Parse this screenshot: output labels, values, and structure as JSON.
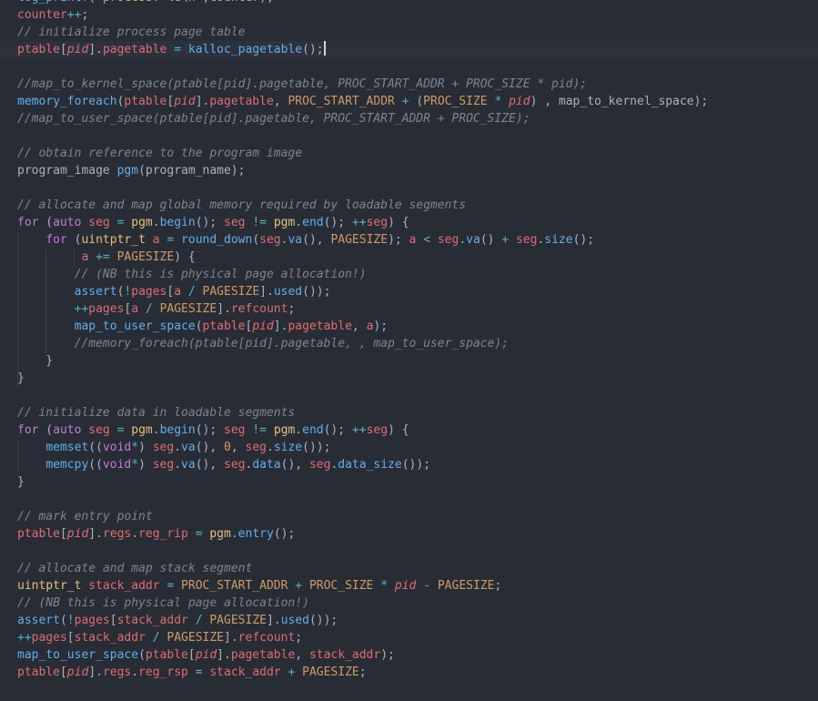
{
  "editor": {
    "current_line": 3,
    "lines": [
      [
        [
          "fn",
          "log_printf"
        ],
        [
          "plain",
          "("
        ],
        [
          "str",
          "\"process: %d\\n\""
        ],
        [
          "plain",
          ",counter);"
        ]
      ],
      [
        [
          "var",
          "counter"
        ],
        [
          "op",
          "++"
        ],
        [
          "plain",
          ";"
        ]
      ],
      [
        [
          "cmt",
          "// initialize process page table"
        ]
      ],
      [
        [
          "var",
          "ptable"
        ],
        [
          "plain",
          "["
        ],
        [
          "ital",
          "pid"
        ],
        [
          "plain",
          "]."
        ],
        [
          "var",
          "pagetable"
        ],
        [
          "plain",
          " "
        ],
        [
          "op",
          "="
        ],
        [
          "plain",
          " "
        ],
        [
          "fn",
          "kalloc_pagetable"
        ],
        [
          "plain",
          "();"
        ]
      ],
      [],
      [
        [
          "cmt",
          "//map_to_kernel_space(ptable[pid].pagetable, PROC_START_ADDR + PROC_SIZE * pid);"
        ]
      ],
      [
        [
          "fn",
          "memory_foreach"
        ],
        [
          "plain",
          "("
        ],
        [
          "var",
          "ptable"
        ],
        [
          "plain",
          "["
        ],
        [
          "ital",
          "pid"
        ],
        [
          "plain",
          "]."
        ],
        [
          "var",
          "pagetable"
        ],
        [
          "plain",
          ", "
        ],
        [
          "macro",
          "PROC_START_ADDR"
        ],
        [
          "plain",
          " "
        ],
        [
          "op",
          "+"
        ],
        [
          "plain",
          " ("
        ],
        [
          "macro",
          "PROC_SIZE"
        ],
        [
          "plain",
          " "
        ],
        [
          "op",
          "*"
        ],
        [
          "plain",
          " "
        ],
        [
          "ital",
          "pid"
        ],
        [
          "plain",
          ") , map_to_kernel_space);"
        ]
      ],
      [
        [
          "cmt",
          "//map_to_user_space(ptable[pid].pagetable, PROC_START_ADDR + PROC_SIZE);"
        ]
      ],
      [],
      [
        [
          "cmt",
          "// obtain reference to the program image"
        ]
      ],
      [
        [
          "plain",
          "program_image "
        ],
        [
          "fn",
          "pgm"
        ],
        [
          "plain",
          "(program_name);"
        ]
      ],
      [],
      [
        [
          "cmt",
          "// allocate and map global memory required by loadable segments"
        ]
      ],
      [
        [
          "kw",
          "for"
        ],
        [
          "plain",
          " ("
        ],
        [
          "kw",
          "auto"
        ],
        [
          "plain",
          " "
        ],
        [
          "var",
          "seg"
        ],
        [
          "plain",
          " "
        ],
        [
          "op",
          "="
        ],
        [
          "plain",
          " "
        ],
        [
          "type",
          "pgm"
        ],
        [
          "plain",
          "."
        ],
        [
          "fn",
          "begin"
        ],
        [
          "plain",
          "(); "
        ],
        [
          "var",
          "seg"
        ],
        [
          "plain",
          " "
        ],
        [
          "op",
          "!="
        ],
        [
          "plain",
          " "
        ],
        [
          "type",
          "pgm"
        ],
        [
          "plain",
          "."
        ],
        [
          "fn",
          "end"
        ],
        [
          "plain",
          "(); "
        ],
        [
          "op",
          "++"
        ],
        [
          "var",
          "seg"
        ],
        [
          "plain",
          ") {"
        ]
      ],
      [
        [
          "plain",
          "    "
        ],
        [
          "kw",
          "for"
        ],
        [
          "plain",
          " ("
        ],
        [
          "type",
          "uintptr_t"
        ],
        [
          "plain",
          " "
        ],
        [
          "var",
          "a"
        ],
        [
          "plain",
          " "
        ],
        [
          "op",
          "="
        ],
        [
          "plain",
          " "
        ],
        [
          "fn",
          "round_down"
        ],
        [
          "plain",
          "("
        ],
        [
          "var",
          "seg"
        ],
        [
          "plain",
          "."
        ],
        [
          "fn",
          "va"
        ],
        [
          "plain",
          "(), "
        ],
        [
          "macro",
          "PAGESIZE"
        ],
        [
          "plain",
          "); "
        ],
        [
          "var",
          "a"
        ],
        [
          "plain",
          " "
        ],
        [
          "op",
          "<"
        ],
        [
          "plain",
          " "
        ],
        [
          "var",
          "seg"
        ],
        [
          "plain",
          "."
        ],
        [
          "fn",
          "va"
        ],
        [
          "plain",
          "() "
        ],
        [
          "op",
          "+"
        ],
        [
          "plain",
          " "
        ],
        [
          "var",
          "seg"
        ],
        [
          "plain",
          "."
        ],
        [
          "fn",
          "size"
        ],
        [
          "plain",
          "();"
        ]
      ],
      [
        [
          "plain",
          "         "
        ],
        [
          "var",
          "a"
        ],
        [
          "plain",
          " "
        ],
        [
          "op",
          "+="
        ],
        [
          "plain",
          " "
        ],
        [
          "macro",
          "PAGESIZE"
        ],
        [
          "plain",
          ") {"
        ]
      ],
      [
        [
          "plain",
          "        "
        ],
        [
          "cmt",
          "// (NB this is physical page allocation!)"
        ]
      ],
      [
        [
          "plain",
          "        "
        ],
        [
          "fn",
          "assert"
        ],
        [
          "plain",
          "("
        ],
        [
          "op",
          "!"
        ],
        [
          "var",
          "pages"
        ],
        [
          "plain",
          "["
        ],
        [
          "var",
          "a"
        ],
        [
          "plain",
          " "
        ],
        [
          "op",
          "/"
        ],
        [
          "plain",
          " "
        ],
        [
          "macro",
          "PAGESIZE"
        ],
        [
          "plain",
          "]."
        ],
        [
          "fn",
          "used"
        ],
        [
          "plain",
          "());"
        ]
      ],
      [
        [
          "plain",
          "        "
        ],
        [
          "op",
          "++"
        ],
        [
          "var",
          "pages"
        ],
        [
          "plain",
          "["
        ],
        [
          "var",
          "a"
        ],
        [
          "plain",
          " "
        ],
        [
          "op",
          "/"
        ],
        [
          "plain",
          " "
        ],
        [
          "macro",
          "PAGESIZE"
        ],
        [
          "plain",
          "]."
        ],
        [
          "var",
          "refcount"
        ],
        [
          "plain",
          ";"
        ]
      ],
      [
        [
          "plain",
          "        "
        ],
        [
          "fn",
          "map_to_user_space"
        ],
        [
          "plain",
          "("
        ],
        [
          "var",
          "ptable"
        ],
        [
          "plain",
          "["
        ],
        [
          "ital",
          "pid"
        ],
        [
          "plain",
          "]."
        ],
        [
          "var",
          "pagetable"
        ],
        [
          "plain",
          ", "
        ],
        [
          "var",
          "a"
        ],
        [
          "plain",
          ");"
        ]
      ],
      [
        [
          "plain",
          "        "
        ],
        [
          "cmt",
          "//memory_foreach(ptable[pid].pagetable, , map_to_user_space);"
        ]
      ],
      [
        [
          "plain",
          "    }"
        ]
      ],
      [
        [
          "plain",
          "}"
        ]
      ],
      [],
      [
        [
          "cmt",
          "// initialize data in loadable segments"
        ]
      ],
      [
        [
          "kw",
          "for"
        ],
        [
          "plain",
          " ("
        ],
        [
          "kw",
          "auto"
        ],
        [
          "plain",
          " "
        ],
        [
          "var",
          "seg"
        ],
        [
          "plain",
          " "
        ],
        [
          "op",
          "="
        ],
        [
          "plain",
          " "
        ],
        [
          "type",
          "pgm"
        ],
        [
          "plain",
          "."
        ],
        [
          "fn",
          "begin"
        ],
        [
          "plain",
          "(); "
        ],
        [
          "var",
          "seg"
        ],
        [
          "plain",
          " "
        ],
        [
          "op",
          "!="
        ],
        [
          "plain",
          " "
        ],
        [
          "type",
          "pgm"
        ],
        [
          "plain",
          "."
        ],
        [
          "fn",
          "end"
        ],
        [
          "plain",
          "(); "
        ],
        [
          "op",
          "++"
        ],
        [
          "var",
          "seg"
        ],
        [
          "plain",
          ") {"
        ]
      ],
      [
        [
          "plain",
          "    "
        ],
        [
          "fn",
          "memset"
        ],
        [
          "plain",
          "(("
        ],
        [
          "kw",
          "void"
        ],
        [
          "op",
          "*"
        ],
        [
          "plain",
          ") "
        ],
        [
          "var",
          "seg"
        ],
        [
          "plain",
          "."
        ],
        [
          "fn",
          "va"
        ],
        [
          "plain",
          "(), "
        ],
        [
          "num",
          "0"
        ],
        [
          "plain",
          ", "
        ],
        [
          "var",
          "seg"
        ],
        [
          "plain",
          "."
        ],
        [
          "fn",
          "size"
        ],
        [
          "plain",
          "());"
        ]
      ],
      [
        [
          "plain",
          "    "
        ],
        [
          "fn",
          "memcpy"
        ],
        [
          "plain",
          "(("
        ],
        [
          "kw",
          "void"
        ],
        [
          "op",
          "*"
        ],
        [
          "plain",
          ") "
        ],
        [
          "var",
          "seg"
        ],
        [
          "plain",
          "."
        ],
        [
          "fn",
          "va"
        ],
        [
          "plain",
          "(), "
        ],
        [
          "var",
          "seg"
        ],
        [
          "plain",
          "."
        ],
        [
          "fn",
          "data"
        ],
        [
          "plain",
          "(), "
        ],
        [
          "var",
          "seg"
        ],
        [
          "plain",
          "."
        ],
        [
          "fn",
          "data_size"
        ],
        [
          "plain",
          "());"
        ]
      ],
      [
        [
          "plain",
          "}"
        ]
      ],
      [],
      [
        [
          "cmt",
          "// mark entry point"
        ]
      ],
      [
        [
          "var",
          "ptable"
        ],
        [
          "plain",
          "["
        ],
        [
          "ital",
          "pid"
        ],
        [
          "plain",
          "]."
        ],
        [
          "var",
          "regs"
        ],
        [
          "plain",
          "."
        ],
        [
          "var",
          "reg_rip"
        ],
        [
          "plain",
          " "
        ],
        [
          "op",
          "="
        ],
        [
          "plain",
          " "
        ],
        [
          "type",
          "pgm"
        ],
        [
          "plain",
          "."
        ],
        [
          "fn",
          "entry"
        ],
        [
          "plain",
          "();"
        ]
      ],
      [],
      [
        [
          "cmt",
          "// allocate and map stack segment"
        ]
      ],
      [
        [
          "type",
          "uintptr_t"
        ],
        [
          "plain",
          " "
        ],
        [
          "var",
          "stack_addr"
        ],
        [
          "plain",
          " "
        ],
        [
          "op",
          "="
        ],
        [
          "plain",
          " "
        ],
        [
          "macro",
          "PROC_START_ADDR"
        ],
        [
          "plain",
          " "
        ],
        [
          "op",
          "+"
        ],
        [
          "plain",
          " "
        ],
        [
          "macro",
          "PROC_SIZE"
        ],
        [
          "plain",
          " "
        ],
        [
          "op",
          "*"
        ],
        [
          "plain",
          " "
        ],
        [
          "ital",
          "pid"
        ],
        [
          "plain",
          " "
        ],
        [
          "op",
          "-"
        ],
        [
          "plain",
          " "
        ],
        [
          "macro",
          "PAGESIZE"
        ],
        [
          "plain",
          ";"
        ]
      ],
      [
        [
          "cmt",
          "// (NB this is physical page allocation!)"
        ]
      ],
      [
        [
          "fn",
          "assert"
        ],
        [
          "plain",
          "("
        ],
        [
          "op",
          "!"
        ],
        [
          "var",
          "pages"
        ],
        [
          "plain",
          "["
        ],
        [
          "var",
          "stack_addr"
        ],
        [
          "plain",
          " "
        ],
        [
          "op",
          "/"
        ],
        [
          "plain",
          " "
        ],
        [
          "macro",
          "PAGESIZE"
        ],
        [
          "plain",
          "]."
        ],
        [
          "fn",
          "used"
        ],
        [
          "plain",
          "());"
        ]
      ],
      [
        [
          "op",
          "++"
        ],
        [
          "var",
          "pages"
        ],
        [
          "plain",
          "["
        ],
        [
          "var",
          "stack_addr"
        ],
        [
          "plain",
          " "
        ],
        [
          "op",
          "/"
        ],
        [
          "plain",
          " "
        ],
        [
          "macro",
          "PAGESIZE"
        ],
        [
          "plain",
          "]."
        ],
        [
          "var",
          "refcount"
        ],
        [
          "plain",
          ";"
        ]
      ],
      [
        [
          "fn",
          "map_to_user_space"
        ],
        [
          "plain",
          "("
        ],
        [
          "var",
          "ptable"
        ],
        [
          "plain",
          "["
        ],
        [
          "ital",
          "pid"
        ],
        [
          "plain",
          "]."
        ],
        [
          "var",
          "pagetable"
        ],
        [
          "plain",
          ", "
        ],
        [
          "var",
          "stack_addr"
        ],
        [
          "plain",
          ");"
        ]
      ],
      [
        [
          "var",
          "ptable"
        ],
        [
          "plain",
          "["
        ],
        [
          "ital",
          "pid"
        ],
        [
          "plain",
          "]."
        ],
        [
          "var",
          "regs"
        ],
        [
          "plain",
          "."
        ],
        [
          "var",
          "reg_rsp"
        ],
        [
          "plain",
          " "
        ],
        [
          "op",
          "="
        ],
        [
          "plain",
          " "
        ],
        [
          "var",
          "stack_addr"
        ],
        [
          "plain",
          " "
        ],
        [
          "op",
          "+"
        ],
        [
          "plain",
          " "
        ],
        [
          "macro",
          "PAGESIZE"
        ],
        [
          "plain",
          ";"
        ]
      ]
    ]
  }
}
